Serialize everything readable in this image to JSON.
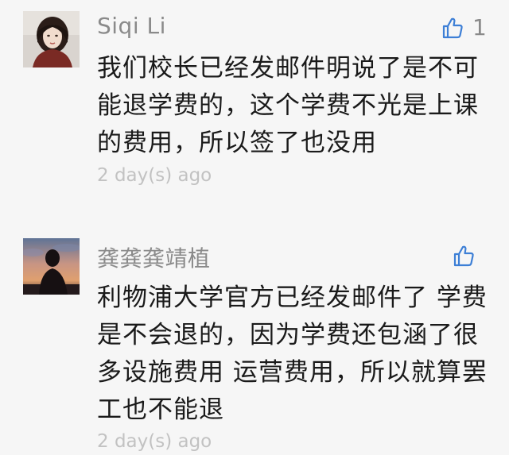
{
  "comments": [
    {
      "author": "Siqi Li",
      "avatar": "woman-portrait-avatar",
      "like_icon": "thumbs-up-icon",
      "like_count": "1",
      "text_lines": [
        "我们校长已经发邮件明说了是不可",
        "能退学费的，这个学费不光是上课",
        "的费用，所以签了也没用"
      ],
      "time": "2 day(s) ago"
    },
    {
      "author": "龚龚龚靖植",
      "avatar": "silhouette-sunset-avatar",
      "like_icon": "thumbs-up-icon",
      "like_count": "",
      "text_lines": [
        "利物浦大学官方已经发邮件了 学费",
        "是不会退的，因为学费还包涵了很",
        "多设施费用 运营费用，所以就算罢",
        "工也不能退"
      ],
      "time": "2 day(s) ago"
    }
  ],
  "colors": {
    "background": "#f6f6f6",
    "accent": "#3d7fd6",
    "name": "#8a8a8a",
    "text": "#1a1a1a",
    "time": "#c2c2c2"
  }
}
